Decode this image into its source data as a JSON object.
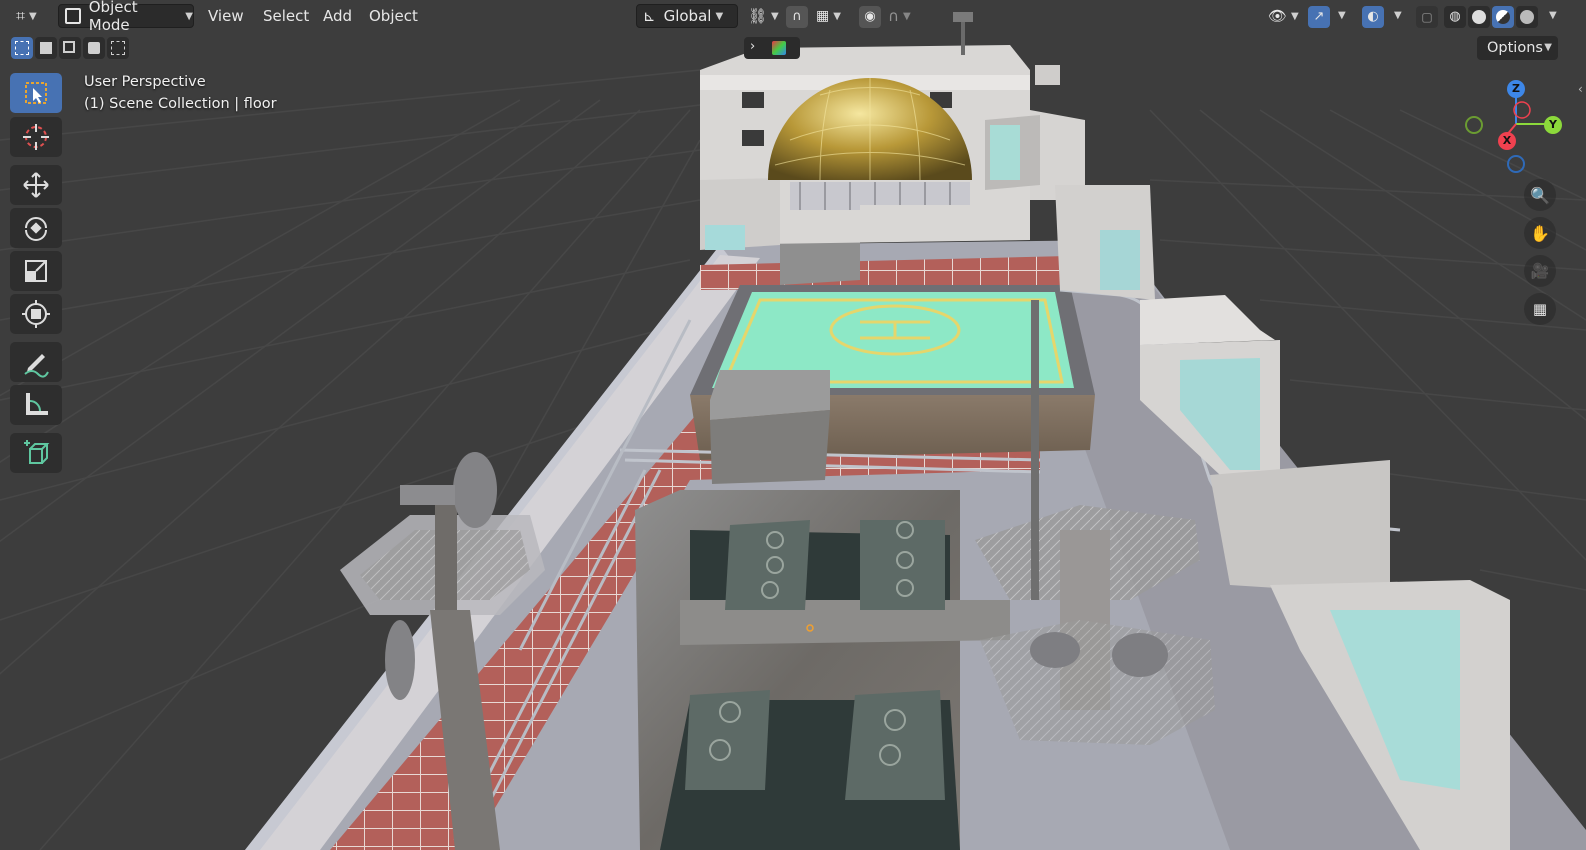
{
  "header": {
    "mode_label": "Object Mode",
    "menus": [
      "View",
      "Select",
      "Add",
      "Object"
    ],
    "transform_orientation": "Global",
    "options_label": "Options"
  },
  "viewport": {
    "view_name": "User Perspective",
    "collection_info": "(1) Scene Collection | floor"
  },
  "gizmo": {
    "z_label": "Z",
    "y_label": "Y",
    "x_label": "X",
    "colors": {
      "x": "#f0414f",
      "y": "#8cd93b",
      "z": "#3d87e8"
    }
  },
  "toolbar": {
    "tools": [
      "select-box",
      "cursor",
      "move",
      "rotate",
      "scale",
      "transform",
      "annotate",
      "measure",
      "add-cube"
    ],
    "active": "select-box"
  },
  "colors": {
    "accent": "#4772b3",
    "viewport_bg": "#3d3d3d",
    "helipad": "#8de8c6",
    "helipad_line": "#e5d66c",
    "brick": "#b5605a",
    "dome_gold": "#c9aa4a"
  }
}
